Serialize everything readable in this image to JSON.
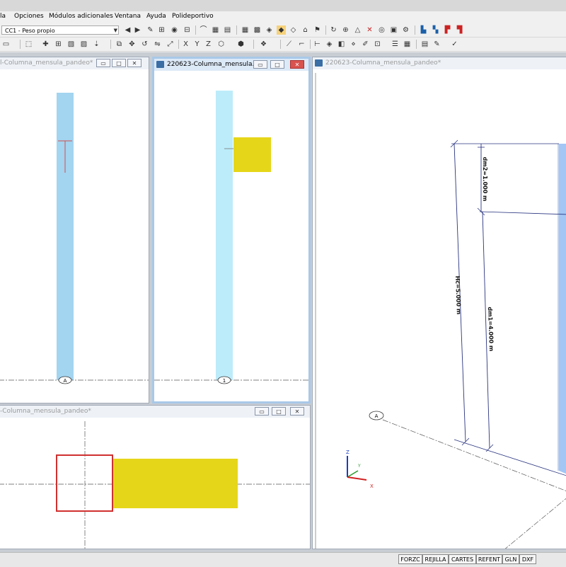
{
  "menu": {
    "items": [
      "la",
      "Opciones",
      "Módulos adicionales",
      "Ventana",
      "Ayuda",
      "Polideportivo"
    ]
  },
  "toolbar": {
    "load_case": "CC1 - Peso propio"
  },
  "windows": {
    "top_left": {
      "title": "l-Columna_mensula_pandeo*",
      "axis_label": "A"
    },
    "top_middle": {
      "title": "220623-Columna_mensula...",
      "axis_label": "1"
    },
    "bottom_left": {
      "title": "-Columna_mensula_pandeo*"
    },
    "right_3d": {
      "title": "220623-Columna_mensula_pandeo*",
      "axis_label": "A",
      "dim_dm2": "dm2=1.000 m",
      "dim_hc": "Hc=5.000 m",
      "dim_dm1": "dm1=4.000 m",
      "axis_z": "Z",
      "axis_y": "Y",
      "axis_x": "X"
    }
  },
  "status_tabs": [
    "FORZC",
    "REJILLA",
    "CARTES",
    "REFENT",
    "GLN",
    "DXF"
  ],
  "colors": {
    "column_blue": "#a3d4f0",
    "column_light": "#bcecfa",
    "load_yellow": "#e6d619",
    "section_red": "#d03030",
    "dim_line": "#2a3580"
  }
}
